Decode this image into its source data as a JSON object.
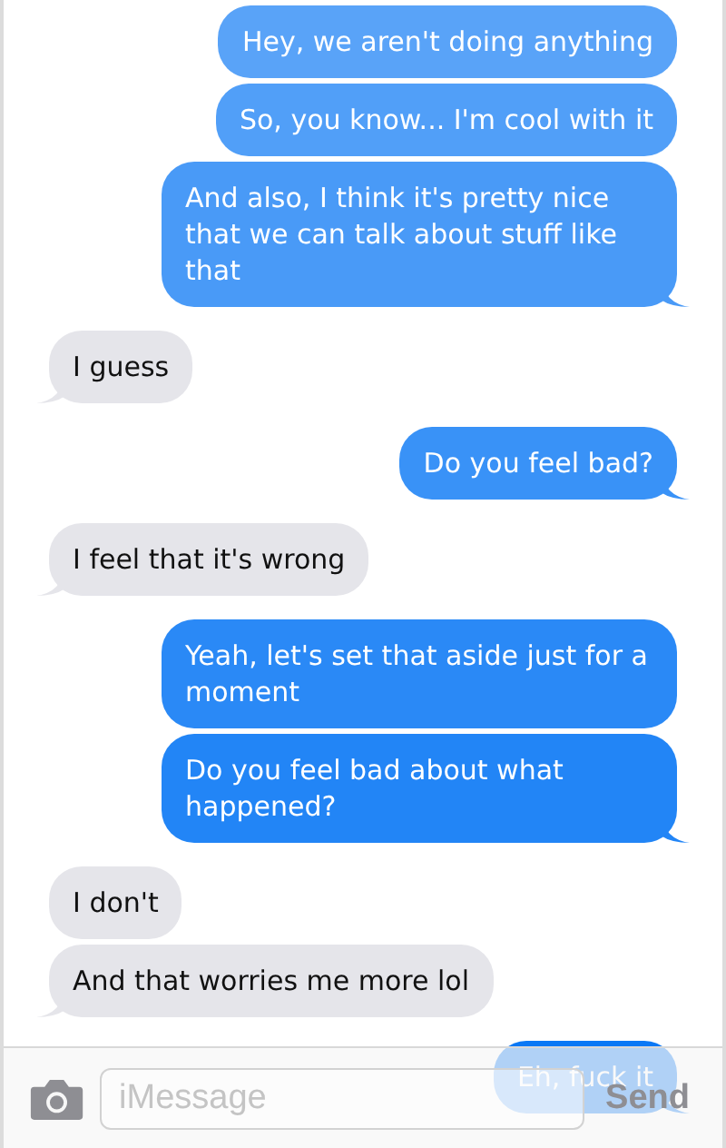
{
  "messages": [
    {
      "kind": "sent",
      "text": "Hey, we aren't doing anything",
      "tail": false
    },
    {
      "kind": "sent",
      "text": "So, you know... I'm cool with it",
      "tail": false
    },
    {
      "kind": "sent",
      "text": "And also, I think it's pretty nice that we can talk about stuff like that",
      "tail": true
    },
    {
      "kind": "received",
      "text": "I guess",
      "tail": true
    },
    {
      "kind": "sent",
      "text": "Do you feel bad?",
      "tail": true
    },
    {
      "kind": "received",
      "text": "I feel that it's wrong",
      "tail": true
    },
    {
      "kind": "sent",
      "text": "Yeah, let's set that aside just for a moment",
      "tail": false
    },
    {
      "kind": "sent",
      "text": "Do you feel bad about what happened?",
      "tail": true
    },
    {
      "kind": "received",
      "text": "I don't",
      "tail": false
    },
    {
      "kind": "received",
      "text": "And that worries me more lol",
      "tail": true
    },
    {
      "kind": "sent",
      "text": "Eh, fuck it",
      "tail": true
    }
  ],
  "composer": {
    "placeholder": "iMessage",
    "send": "Send"
  }
}
